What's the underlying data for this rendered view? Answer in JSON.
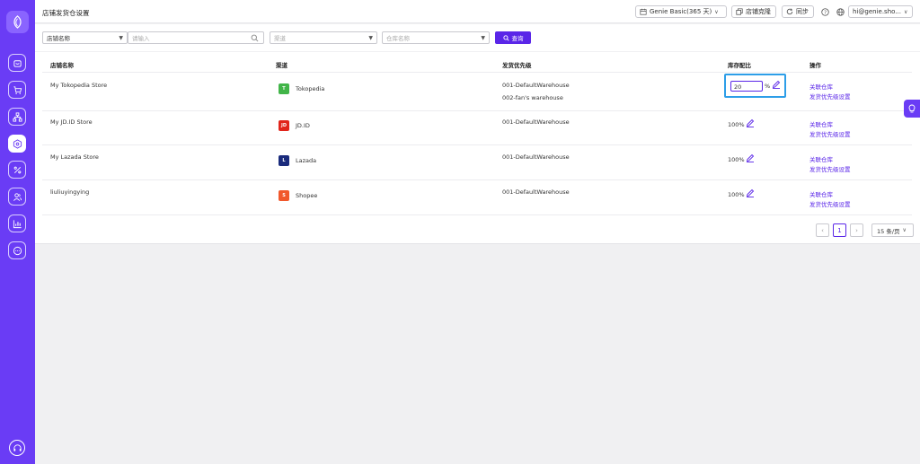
{
  "colors": {
    "brand": "#6a3cf5",
    "primary": "#5a26e8",
    "highlight": "#2d9ee8"
  },
  "sidebar": {
    "logo": "leaf-logo-icon",
    "items": [
      {
        "icon": "store-icon",
        "active": false
      },
      {
        "icon": "cart-icon",
        "active": false
      },
      {
        "icon": "hierarchy-icon",
        "active": false
      },
      {
        "icon": "box-settings-icon",
        "active": true
      },
      {
        "icon": "discount-icon",
        "active": false
      },
      {
        "icon": "users-icon",
        "active": false
      },
      {
        "icon": "chart-icon",
        "active": false
      },
      {
        "icon": "message-icon",
        "active": false
      }
    ],
    "support_icon": "headset-icon"
  },
  "header": {
    "title": "店铺发货仓设置",
    "plan": "Genie Basic(365 天)",
    "clone_label": "店铺克隆",
    "sync_label": "同步",
    "user": "hi@genie.sho..."
  },
  "filters": {
    "field_select": "店铺名称",
    "search_placeholder": "请输入",
    "channel_placeholder": "渠道",
    "warehouse_placeholder": "仓库名称",
    "search_button": "查询"
  },
  "table": {
    "headers": {
      "store": "店铺名称",
      "channel": "渠道",
      "priority": "发货优先级",
      "stock": "库存配比",
      "actions": "操作"
    },
    "rows": [
      {
        "store": "My Tokopedia Store",
        "channel": "Tokopedia",
        "channel_color": "#42b549",
        "channel_mark": "T",
        "warehouses": [
          "001-DefaultWarehouse",
          "002-fan's warehouse"
        ],
        "stock": "20",
        "stock_unit": "%",
        "editing": true,
        "action1": "关联仓库",
        "action2": "发货优先级设置"
      },
      {
        "store": "My JD.ID Store",
        "channel": "JD.ID",
        "channel_color": "#e1251b",
        "channel_mark": "JD",
        "warehouses": [
          "001-DefaultWarehouse"
        ],
        "stock": "100%",
        "editing": false,
        "action1": "关联仓库",
        "action2": "发货优先级设置"
      },
      {
        "store": "My Lazada Store",
        "channel": "Lazada",
        "channel_color": "#1a2b7c",
        "channel_mark": "L",
        "warehouses": [
          "001-DefaultWarehouse"
        ],
        "stock": "100%",
        "editing": false,
        "action1": "关联仓库",
        "action2": "发货优先级设置"
      },
      {
        "store": "liuliuyingying",
        "channel": "Shopee",
        "channel_color": "#f1582c",
        "channel_mark": "S",
        "warehouses": [
          "001-DefaultWarehouse"
        ],
        "stock": "100%",
        "editing": false,
        "action1": "关联仓库",
        "action2": "发货优先级设置"
      }
    ]
  },
  "pagination": {
    "current": "1",
    "page_size": "15 条/页"
  }
}
